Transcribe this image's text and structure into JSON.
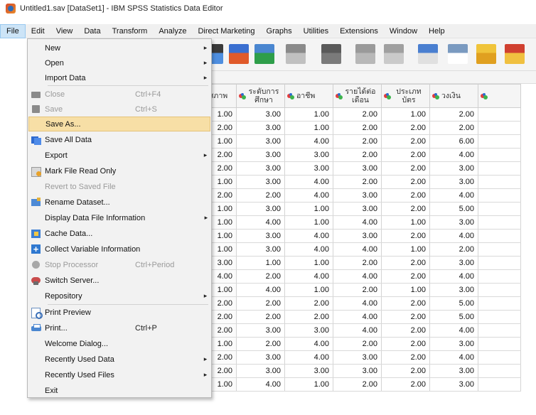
{
  "window": {
    "title": "Untitled1.sav [DataSet1] - IBM SPSS Statistics Data Editor"
  },
  "menubar": [
    {
      "label": "File",
      "active": true
    },
    {
      "label": "Edit"
    },
    {
      "label": "View"
    },
    {
      "label": "Data"
    },
    {
      "label": "Transform"
    },
    {
      "label": "Analyze"
    },
    {
      "label": "Direct Marketing"
    },
    {
      "label": "Graphs"
    },
    {
      "label": "Utilities"
    },
    {
      "label": "Extensions"
    },
    {
      "label": "Window"
    },
    {
      "label": "Help"
    }
  ],
  "toolbar": {
    "icons": [
      "select-cases-icon",
      "import-icon",
      "variables-icon",
      "chart-icon",
      "binoculars-icon",
      "split-file-icon",
      "weight-icon",
      "value-labels-icon",
      "scales-icon",
      "grid-icon",
      "use-sets-icon"
    ]
  },
  "file_menu": {
    "items": [
      {
        "label": "New",
        "icon": "",
        "shortcut": "",
        "submenu": true,
        "disabled": false
      },
      {
        "label": "Open",
        "icon": "",
        "shortcut": "",
        "submenu": true,
        "disabled": false
      },
      {
        "label": "Import Data",
        "icon": "",
        "shortcut": "",
        "submenu": true,
        "disabled": false
      },
      {
        "label": "Close",
        "icon": "close-file-icon",
        "shortcut": "Ctrl+F4",
        "submenu": false,
        "disabled": true
      },
      {
        "label": "Save",
        "icon": "save-icon",
        "shortcut": "Ctrl+S",
        "submenu": false,
        "disabled": true
      },
      {
        "label": "Save As...",
        "icon": "",
        "shortcut": "",
        "submenu": false,
        "disabled": false,
        "highlight": true
      },
      {
        "label": "Save All Data",
        "icon": "save-all-icon",
        "shortcut": "",
        "submenu": false,
        "disabled": false
      },
      {
        "label": "Export",
        "icon": "",
        "shortcut": "",
        "submenu": true,
        "disabled": false
      },
      {
        "label": "Mark File Read Only",
        "icon": "read-only-icon",
        "shortcut": "",
        "submenu": false,
        "disabled": false
      },
      {
        "label": "Revert to Saved File",
        "icon": "",
        "shortcut": "",
        "submenu": false,
        "disabled": true
      },
      {
        "label": "Rename Dataset...",
        "icon": "rename-icon",
        "shortcut": "",
        "submenu": false,
        "disabled": false
      },
      {
        "label": "Display Data File Information",
        "icon": "",
        "shortcut": "",
        "submenu": true,
        "disabled": false
      },
      {
        "label": "Cache Data...",
        "icon": "cache-icon",
        "shortcut": "",
        "submenu": false,
        "disabled": false
      },
      {
        "label": "Collect Variable Information",
        "icon": "collect-icon",
        "shortcut": "",
        "submenu": false,
        "disabled": false
      },
      {
        "label": "Stop Processor",
        "icon": "stop-icon",
        "shortcut": "Ctrl+Period",
        "submenu": false,
        "disabled": true
      },
      {
        "label": "Switch Server...",
        "icon": "server-icon",
        "shortcut": "",
        "submenu": false,
        "disabled": false
      },
      {
        "label": "Repository",
        "icon": "",
        "shortcut": "",
        "submenu": true,
        "disabled": false
      },
      {
        "label": "Print Preview",
        "icon": "print-preview-icon",
        "shortcut": "",
        "submenu": false,
        "disabled": false
      },
      {
        "label": "Print...",
        "icon": "print-icon",
        "shortcut": "Ctrl+P",
        "submenu": false,
        "disabled": false
      },
      {
        "label": "Welcome Dialog...",
        "icon": "",
        "shortcut": "",
        "submenu": false,
        "disabled": false
      },
      {
        "label": "Recently Used Data",
        "icon": "",
        "shortcut": "",
        "submenu": true,
        "disabled": false
      },
      {
        "label": "Recently Used Files",
        "icon": "",
        "shortcut": "",
        "submenu": true,
        "disabled": false
      },
      {
        "label": "Exit",
        "icon": "",
        "shortcut": "",
        "submenu": false,
        "disabled": false
      }
    ]
  },
  "grid": {
    "columns": [
      {
        "label": "สภาพ"
      },
      {
        "label": "ระดับการศึกษา"
      },
      {
        "label": "อาชีพ"
      },
      {
        "label": "รายได้ต่อเดือน"
      },
      {
        "label": "ประเภทบัตร"
      },
      {
        "label": "วงเงิน"
      },
      {
        "label": ""
      }
    ],
    "rows": [
      [
        "1.00",
        "3.00",
        "1.00",
        "2.00",
        "1.00",
        "2.00"
      ],
      [
        "2.00",
        "3.00",
        "1.00",
        "2.00",
        "2.00",
        "2.00"
      ],
      [
        "1.00",
        "3.00",
        "4.00",
        "2.00",
        "2.00",
        "6.00"
      ],
      [
        "2.00",
        "3.00",
        "3.00",
        "2.00",
        "2.00",
        "4.00"
      ],
      [
        "2.00",
        "3.00",
        "3.00",
        "3.00",
        "2.00",
        "3.00"
      ],
      [
        "1.00",
        "3.00",
        "4.00",
        "2.00",
        "2.00",
        "3.00"
      ],
      [
        "2.00",
        "2.00",
        "4.00",
        "3.00",
        "2.00",
        "4.00"
      ],
      [
        "1.00",
        "3.00",
        "1.00",
        "3.00",
        "2.00",
        "5.00"
      ],
      [
        "1.00",
        "4.00",
        "1.00",
        "4.00",
        "1.00",
        "3.00"
      ],
      [
        "1.00",
        "3.00",
        "4.00",
        "3.00",
        "2.00",
        "4.00"
      ],
      [
        "1.00",
        "3.00",
        "4.00",
        "4.00",
        "1.00",
        "2.00"
      ],
      [
        "3.00",
        "1.00",
        "1.00",
        "2.00",
        "2.00",
        "3.00"
      ],
      [
        "4.00",
        "2.00",
        "4.00",
        "4.00",
        "2.00",
        "4.00"
      ],
      [
        "1.00",
        "4.00",
        "1.00",
        "2.00",
        "1.00",
        "3.00"
      ],
      [
        "2.00",
        "2.00",
        "2.00",
        "4.00",
        "2.00",
        "5.00"
      ],
      [
        "2.00",
        "2.00",
        "2.00",
        "4.00",
        "2.00",
        "5.00"
      ],
      [
        "2.00",
        "3.00",
        "3.00",
        "4.00",
        "2.00",
        "4.00"
      ],
      [
        "1.00",
        "2.00",
        "4.00",
        "2.00",
        "2.00",
        "3.00"
      ],
      [
        "2.00",
        "3.00",
        "4.00",
        "3.00",
        "2.00",
        "4.00"
      ],
      [
        "2.00",
        "3.00",
        "3.00",
        "3.00",
        "2.00",
        "3.00"
      ],
      [
        "1.00",
        "4.00",
        "1.00",
        "2.00",
        "2.00",
        "3.00"
      ]
    ]
  }
}
